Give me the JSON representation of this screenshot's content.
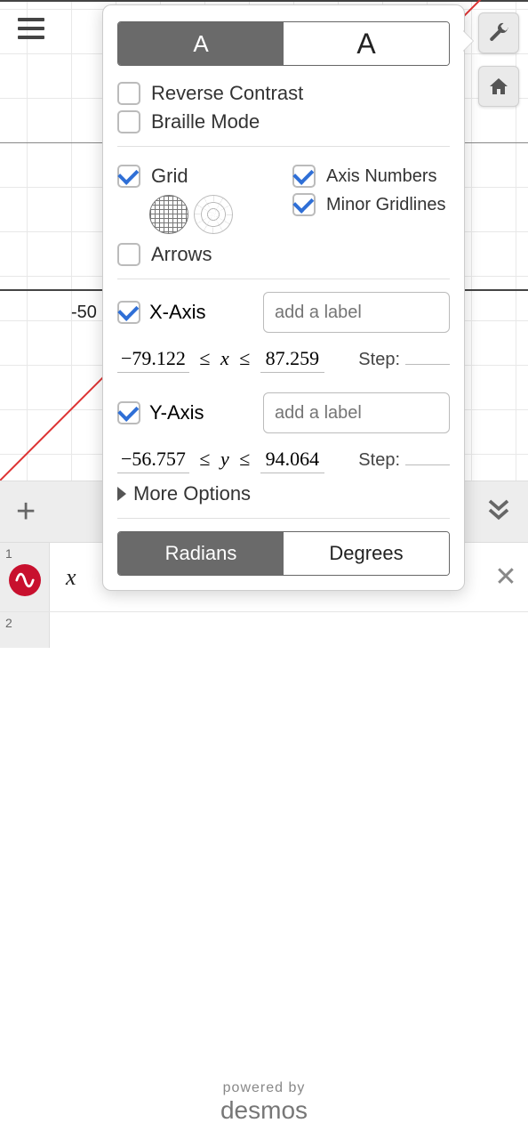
{
  "graph": {
    "tick_label_left": "-50"
  },
  "popover": {
    "font_size_small": "A",
    "font_size_large": "A",
    "reverse_contrast": {
      "label": "Reverse Contrast",
      "checked": false
    },
    "braille_mode": {
      "label": "Braille Mode",
      "checked": false
    },
    "grid": {
      "label": "Grid",
      "checked": true
    },
    "axis_numbers": {
      "label": "Axis Numbers",
      "checked": true
    },
    "minor_gridlines": {
      "label": "Minor Gridlines",
      "checked": true
    },
    "arrows": {
      "label": "Arrows",
      "checked": false
    },
    "x_axis": {
      "label": "X-Axis",
      "checked": true,
      "placeholder": "add a label",
      "min": "−79.122",
      "var": "x",
      "max": "87.259",
      "step_label": "Step:",
      "step": ""
    },
    "y_axis": {
      "label": "Y-Axis",
      "checked": true,
      "placeholder": "add a label",
      "min": "−56.757",
      "var": "y",
      "max": "94.064",
      "step_label": "Step:",
      "step": ""
    },
    "more_options": "More Options",
    "angle_mode": {
      "radians": "Radians",
      "degrees": "Degrees",
      "selected": "radians"
    }
  },
  "expressions": {
    "row1_index": "1",
    "row1_content": "x ",
    "row2_index": "2"
  },
  "footer": {
    "powered_by": "powered by",
    "brand": "desmos"
  }
}
